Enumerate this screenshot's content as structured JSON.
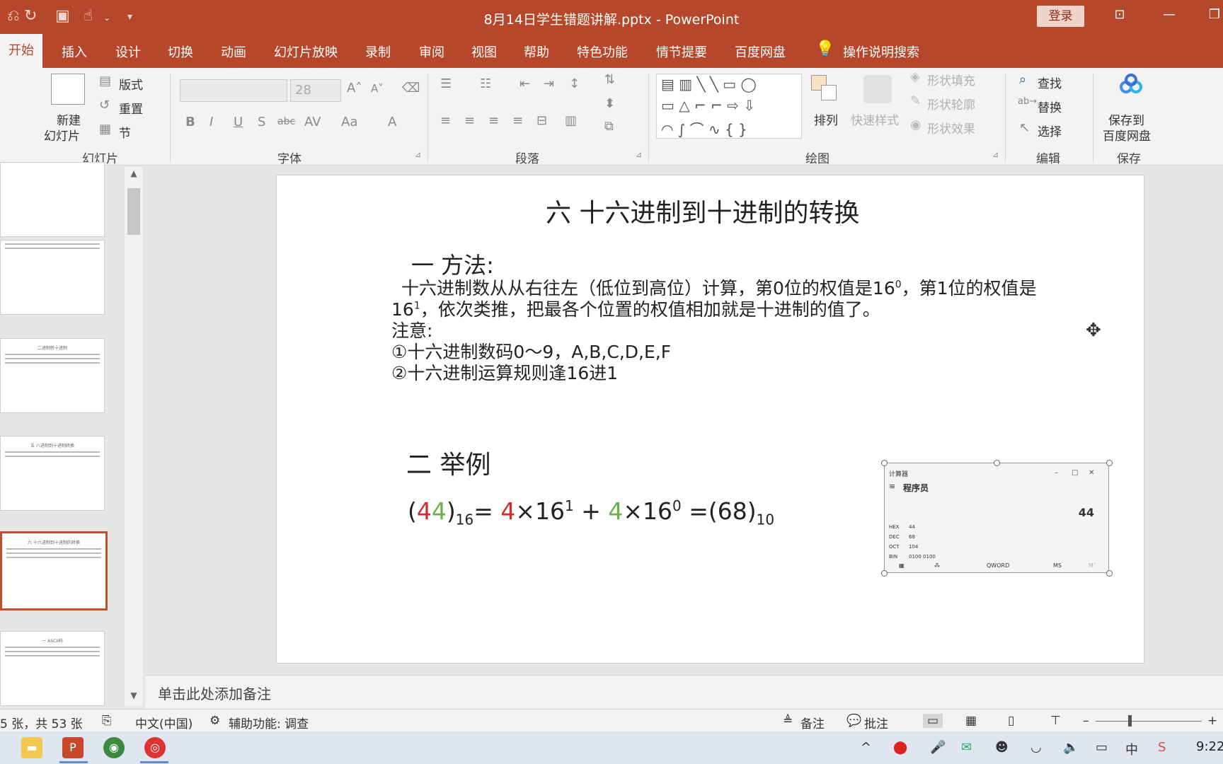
{
  "window": {
    "title": "8月14日学生错题讲解.pptx  -  PowerPoint",
    "login_label": "登录"
  },
  "tabs": [
    "开始",
    "插入",
    "设计",
    "切换",
    "动画",
    "幻灯片放映",
    "录制",
    "审阅",
    "视图",
    "帮助",
    "特色功能",
    "情节提要",
    "百度网盘"
  ],
  "tell_me": "操作说明搜索",
  "ribbon": {
    "slides_group": {
      "new_slide": "新建\n幻灯片",
      "new_slide_line1": "新建",
      "new_slide_line2": "幻灯片",
      "layout": "版式",
      "reset": "重置",
      "section": "节",
      "label": "幻灯片"
    },
    "font_group": {
      "size": "28",
      "label": "字体"
    },
    "paragraph_group": {
      "label": "段落"
    },
    "drawing_group": {
      "arrange": "排列",
      "quick_styles": "快速样式",
      "shape_fill": "形状填充",
      "shape_outline": "形状轮廓",
      "shape_effects": "形状效果",
      "label": "绘图"
    },
    "editing_group": {
      "find": "查找",
      "replace": "替换",
      "select": "选择",
      "label": "编辑"
    },
    "save_group": {
      "save_line1": "保存到",
      "save_line2": "百度网盘",
      "label": "保存"
    }
  },
  "slide": {
    "title": "六     十六进制到十进制的转换",
    "section1": "一 方法:",
    "line1_a": "十六进制数从从右往左（低位到高位）计算，第0位的权值是16",
    "line1_sup1": "0",
    "line1_b": "，第1位的权值是",
    "line2_a": "16",
    "line2_sup": "1",
    "line2_b": "，依次类推，把最各个位置的权值相加就是十进制的值了。",
    "note_label": "注意:",
    "note1": "①十六进制数码0～9，A,B,C,D,E,F",
    "note2": "②十六进制运算规则逢16进1",
    "section2": "二 举例",
    "formula": {
      "open": "(",
      "d1": "4",
      "d2": "4",
      "close": ")",
      "base16": "16",
      "eq": "= ",
      "t1_digit": "4",
      "t1_rest": "×16",
      "exp1": "1",
      "plus": " + ",
      "t2_digit": "4",
      "t2_rest": "×16",
      "exp0": "0",
      "result": "  =(68)",
      "base10": "10"
    },
    "calculator": {
      "title": "计算器",
      "mode": "程序员",
      "display": "44",
      "rows": [
        {
          "k": "HEX",
          "v": "44"
        },
        {
          "k": "DEC",
          "v": "68"
        },
        {
          "k": "OCT",
          "v": "104"
        },
        {
          "k": "BIN",
          "v": "0100 0100"
        }
      ],
      "word": "QWORD",
      "ms": "MS",
      "mplus": "M˅"
    }
  },
  "notes_placeholder": "单击此处添加备注",
  "status": {
    "slide_count": "5 张，共 53 张",
    "language": "中文(中国)",
    "accessibility": "辅助功能: 调查",
    "notes_btn": "备注",
    "comments_btn": "批注"
  },
  "taskbar": {
    "clock": "9:22",
    "ime": "中"
  },
  "colors": {
    "accent": "#b7472a",
    "red_digit": "#d62b2b",
    "green_digit": "#6ab04c"
  }
}
